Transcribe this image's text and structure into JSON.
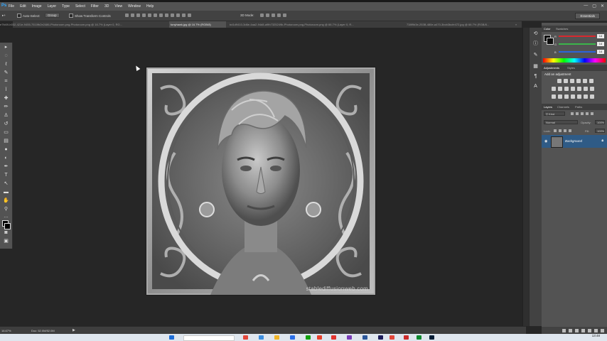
{
  "app": {
    "logo": "Ps",
    "menu": [
      "File",
      "Edit",
      "Image",
      "Layer",
      "Type",
      "Select",
      "Filter",
      "3D",
      "View",
      "Window",
      "Help"
    ],
    "window_buttons": [
      "—",
      "▢",
      "✕"
    ]
  },
  "options_bar": {
    "auto_select_label": "Auto-Select:",
    "auto_select_target": "Group",
    "show_transform_label": "Show Transform Controls",
    "mode_3d_label": "3D Mode:",
    "workspace": "Essentials"
  },
  "tabs": [
    {
      "label": "e7fc69-b032-421e-9455-7510fb2e2486-Photoroom.png-Photoroom.png @ 16.7% (Layer 0, RG...",
      "active": false
    },
    {
      "label": "tonyhawk.jpg @ 16.7% (RGB/8)",
      "active": true
    },
    {
      "label": "bd1d9410-3d6e-4aa2-94d8-a9fb7325249b-Photoroom.png-Photoroom.png @ 66.7% (Layer 0, R...",
      "active": false
    },
    {
      "label": "738f9b3e-253B-480e-a470-3bcb3bcfe472.jpg @ 66.7% (RGB/8...",
      "active": false
    }
  ],
  "canvas": {
    "watermark": "stablediffusionweb.com"
  },
  "status": {
    "zoom": "16.67%",
    "doc": "Doc: 52.0M/52.0M"
  },
  "color_panel": {
    "tabs": [
      "Color",
      "Swatches"
    ],
    "rows": [
      {
        "label": "R",
        "value": "14",
        "color": "#d8292f"
      },
      {
        "label": "G",
        "value": "14",
        "color": "#3bb54a"
      },
      {
        "label": "B",
        "value": "14",
        "color": "#2d64d8"
      }
    ]
  },
  "adjustments_panel": {
    "tabs": [
      "Adjustments",
      "Styles"
    ],
    "title": "Add an adjustment"
  },
  "layers_panel": {
    "tabs": [
      "Layers",
      "Channels",
      "Paths"
    ],
    "kind_label": "Kind",
    "blend_mode": "Normal",
    "opacity_label": "Opacity:",
    "opacity_value": "100%",
    "lock_label": "Lock:",
    "fill_label": "Fill:",
    "fill_value": "100%",
    "layer_name": "Background"
  },
  "taskbar": {
    "clock": "13:48"
  }
}
